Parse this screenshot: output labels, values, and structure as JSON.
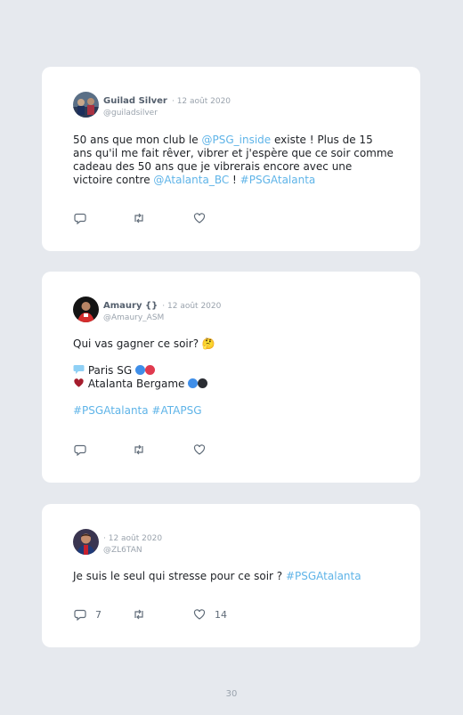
{
  "tweets": [
    {
      "name": "Guilad Silver",
      "date": "· 12 août 2020",
      "handle": "@guiladsilver",
      "text_1": "50 ans que mon club le ",
      "mention_1": "@PSG_inside",
      "text_2": " existe ! Plus de 15 ans qu'il me fait rêver, vibrer et j'espère que ce soir comme cadeau des 50 ans que je vibrerais encore avec une victoire contre ",
      "mention_2": "@Atalanta_BC",
      "text_3": " ! ",
      "hashtag": "#PSGAtalanta"
    },
    {
      "name": "Amaury {}",
      "date": "· 12 août 2020",
      "handle": "@Amaury_ASM",
      "question": "Qui vas gagner ce soir? 🤔",
      "option_1": "Paris SG",
      "option_2": "Atalanta Bergame",
      "hashtags": "#PSGAtalanta #ATAPSG",
      "colors": {
        "psg_blue": "#3f8ee8",
        "psg_red": "#e03a4f",
        "atalanta_black": "#2a2d33",
        "heart": "#a51d2d"
      }
    },
    {
      "name": "",
      "date": "· 12 août 2020",
      "handle": "@ZL6TAN",
      "text": "Je suis le seul qui stresse pour ce soir ? ",
      "hashtag": "#PSGAtalanta",
      "reply_count": "7",
      "like_count": "14"
    }
  ],
  "page_number": "30",
  "icons": [
    "reply-icon",
    "retweet-icon",
    "like-icon",
    "speech-bubble-icon",
    "heart-icon"
  ]
}
